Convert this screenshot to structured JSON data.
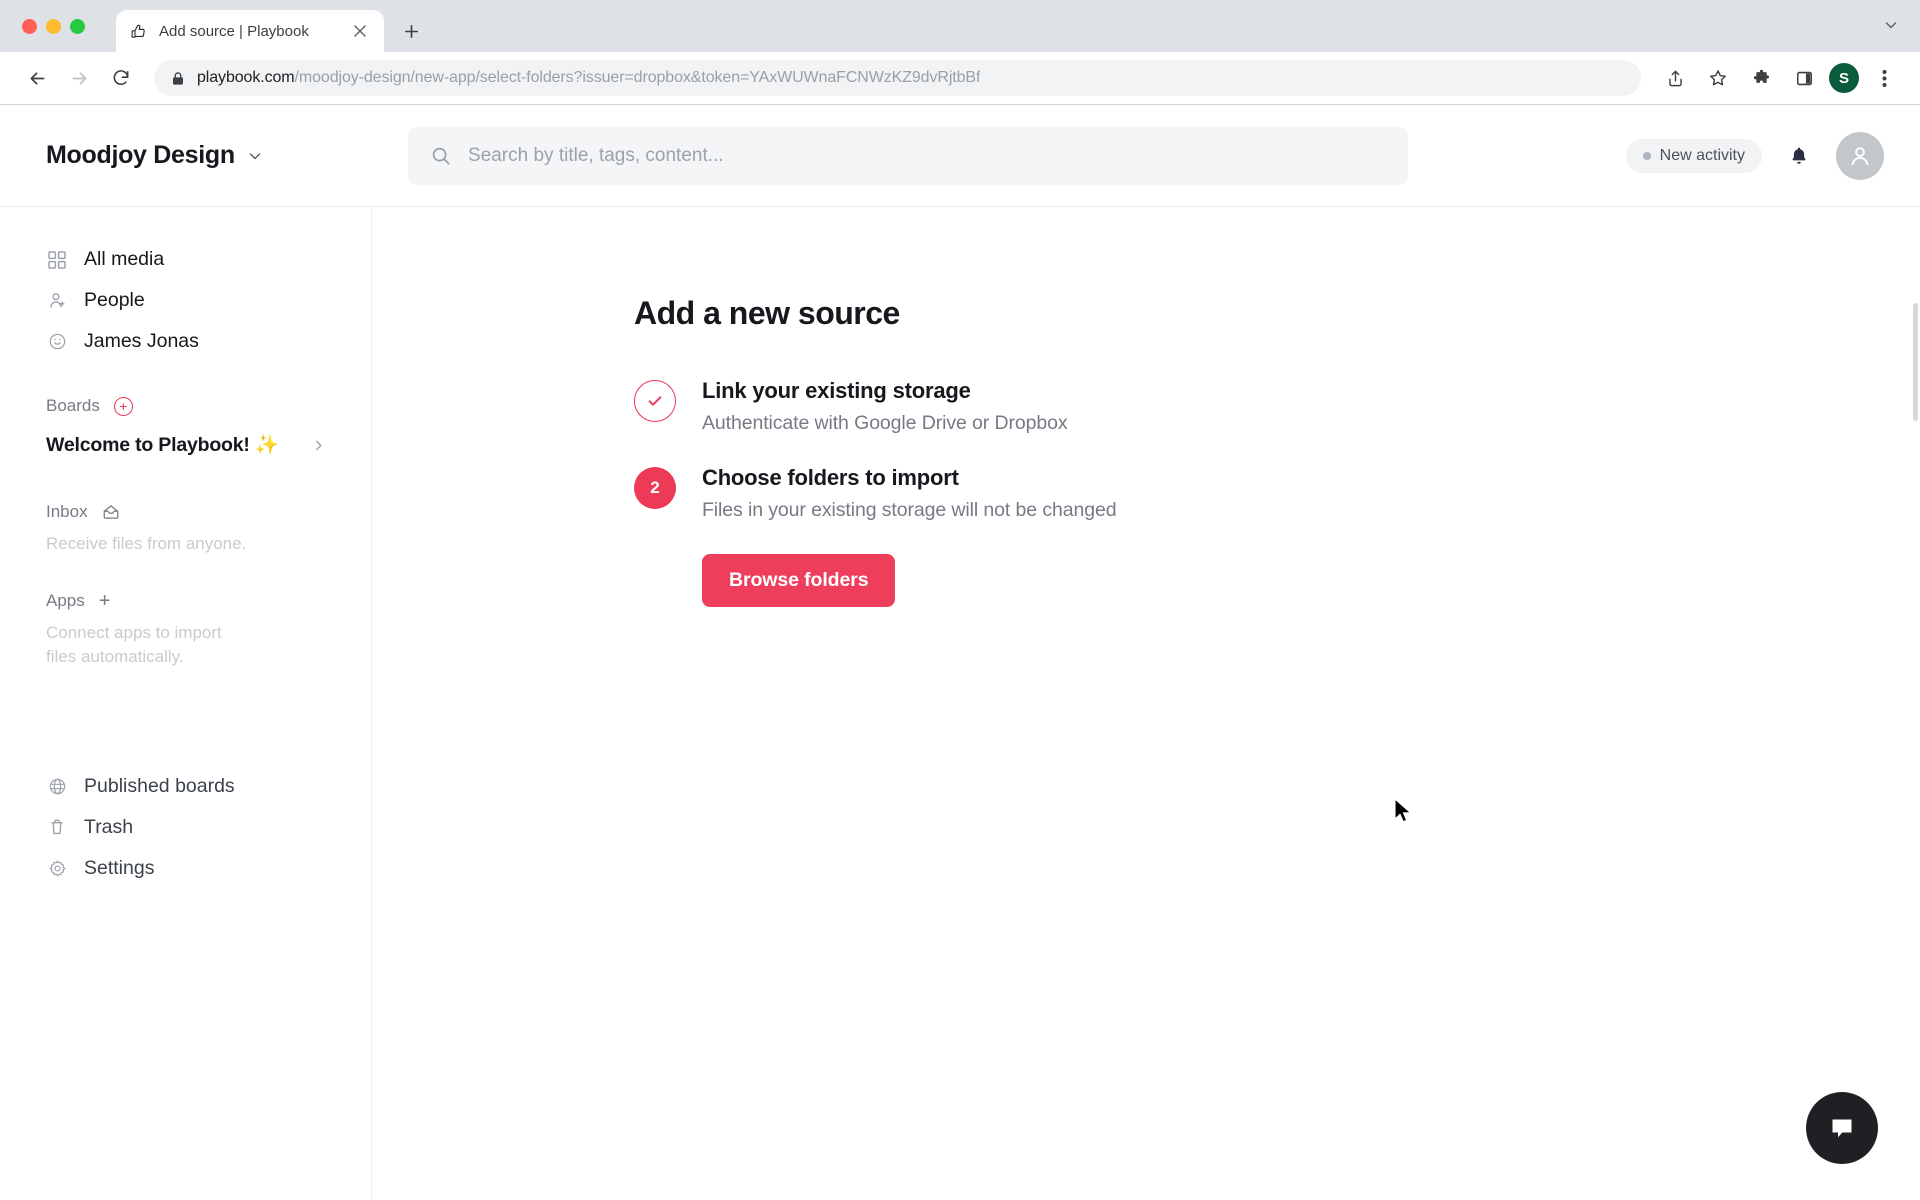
{
  "browser": {
    "tab": {
      "title": "Add source | Playbook",
      "favicon": "thumbs-up-icon",
      "close": "×"
    },
    "new_tab_label": "+",
    "tabstrip_caret": "⌄",
    "url": {
      "domain": "playbook.com",
      "path": "/moodjoy-design/new-app/select-folders?issuer=dropbox&token=YAxWUWnaFCNWzKZ9dvRjtbBf",
      "full": "playbook.com/moodjoy-design/new-app/select-folders?issuer=dropbox&token=YAxWUWnaFCNWzKZ9dvRjtbBf"
    },
    "profile_initial": "S",
    "accent_profile_color": "#0b5c3d"
  },
  "header": {
    "workspace_name": "Moodjoy Design",
    "search_placeholder": "Search by title, tags, content...",
    "search_value": "",
    "activity_label": "New activity"
  },
  "sidebar": {
    "primary": [
      {
        "label": "All media",
        "icon": "grid-icon"
      },
      {
        "label": "People",
        "icon": "person-add-icon"
      },
      {
        "label": "James Jonas",
        "icon": "smiley-icon"
      }
    ],
    "boards": {
      "title": "Boards",
      "add_label": "+",
      "items": [
        {
          "label": "Welcome to Playbook! ✨",
          "chevron": "›"
        }
      ]
    },
    "inbox": {
      "title": "Inbox",
      "description": "Receive files from anyone."
    },
    "apps": {
      "title": "Apps",
      "add_label": "+",
      "description": "Connect apps to import files automatically."
    },
    "bottom": [
      {
        "label": "Published boards",
        "icon": "globe-icon"
      },
      {
        "label": "Trash",
        "icon": "trash-icon"
      },
      {
        "label": "Settings",
        "icon": "gear-icon"
      }
    ]
  },
  "main": {
    "title": "Add a new source",
    "steps": [
      {
        "marker": "✓",
        "state": "done",
        "title": "Link your existing storage",
        "description": "Authenticate with Google Drive or Dropbox"
      },
      {
        "marker": "2",
        "state": "active",
        "title": "Choose folders to import",
        "description": "Files in your existing storage will not be changed"
      }
    ],
    "browse_button": "Browse folders"
  },
  "colors": {
    "accent": "#ef3e5c",
    "accent_outline": "#ec3a57",
    "text_primary": "#16181d",
    "text_muted": "#757a84",
    "chat_fab": "#1f2023"
  }
}
